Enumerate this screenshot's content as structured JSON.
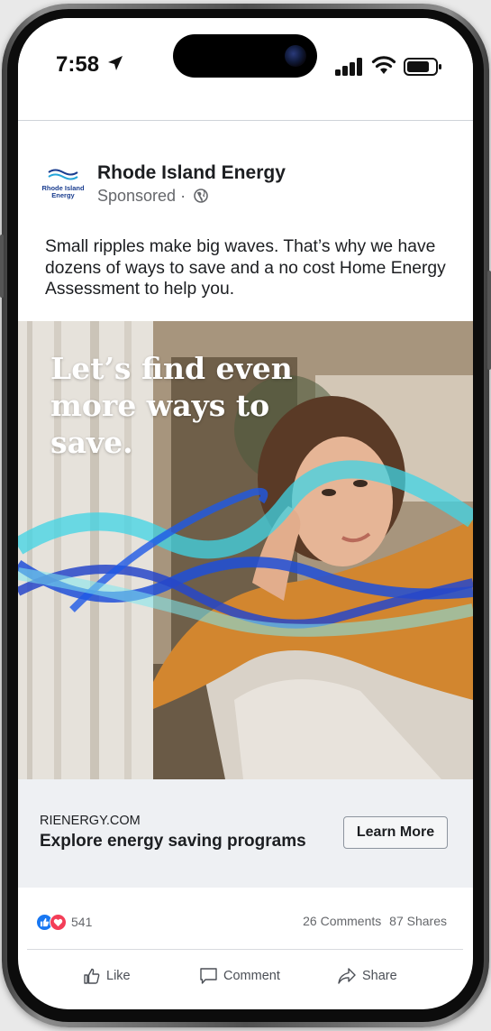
{
  "status_bar": {
    "time": "7:58"
  },
  "post": {
    "advertiser": "Rhode Island Energy",
    "sponsored": "Sponsored",
    "sponsored_sep": "·",
    "logo_text_line1": "Rhode Island",
    "logo_text_line2": "Energy",
    "caption": "Small ripples make big waves. That’s why we have dozens of ways to save and a no cost Home Energy Assessment to help you.",
    "image_headline": "Let’s find even more ways to save."
  },
  "link_preview": {
    "domain": "RIENERGY.COM",
    "title": "Explore energy saving programs",
    "button_label": "Learn More"
  },
  "engagement": {
    "reaction_count": "541",
    "comments": "26 Comments",
    "shares": "87 Shares"
  },
  "actions": {
    "like": "Like",
    "comment": "Comment",
    "share": "Share"
  },
  "colors": {
    "like_blue": "#1877f2",
    "love_red": "#f33e58",
    "brand_blue": "#1a3d8f",
    "wave_blue": "#1e4fd8",
    "wave_cyan": "#3fd4e6"
  },
  "icons": [
    "location-arrow-icon",
    "signal-icon",
    "wifi-icon",
    "battery-icon",
    "globe-icon",
    "like-reaction-icon",
    "love-reaction-icon",
    "thumbs-up-icon",
    "comment-icon",
    "share-icon"
  ]
}
